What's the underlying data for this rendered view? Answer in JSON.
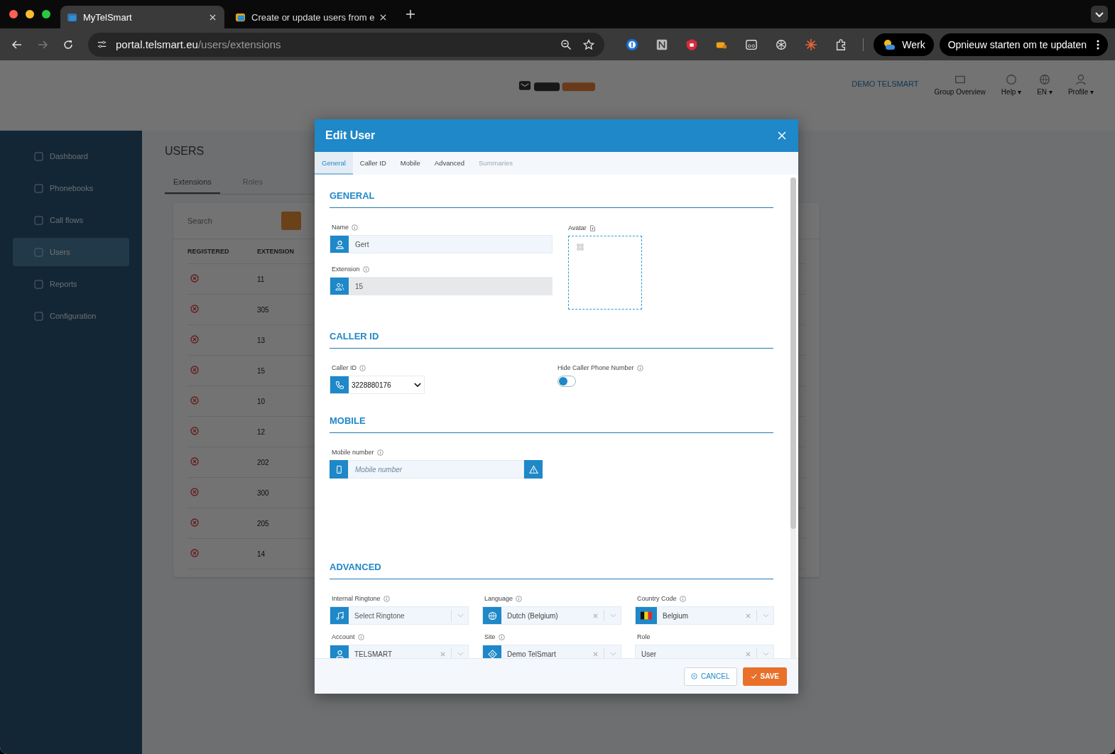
{
  "browser": {
    "tabs": [
      {
        "title": "MyTelSmart",
        "selected": true
      },
      {
        "title": "Create or update users from e",
        "selected": false
      }
    ],
    "url": {
      "host": "portal.telsmart.eu",
      "path": "/users/extensions"
    },
    "profile": "Werk",
    "update_button": "Opnieuw starten om te updaten"
  },
  "header": {
    "account": "DEMO TELSMART",
    "menu": [
      {
        "label": "Group Overview",
        "kind": "group"
      },
      {
        "label": "Help ▾",
        "kind": "help"
      },
      {
        "label": "EN ▾",
        "kind": "globe"
      },
      {
        "label": "Profile ▾",
        "kind": "user"
      }
    ]
  },
  "sidebar": {
    "items": [
      {
        "label": "Dashboard",
        "selected": false
      },
      {
        "label": "Phonebooks",
        "selected": false
      },
      {
        "label": "Call flows",
        "selected": false
      },
      {
        "label": "Users",
        "selected": true
      },
      {
        "label": "Reports",
        "selected": false
      },
      {
        "label": "Configuration",
        "selected": false
      }
    ]
  },
  "page": {
    "title": "USERS",
    "tabs": [
      {
        "label": "Extensions",
        "selected": true
      },
      {
        "label": "Roles",
        "selected": false
      }
    ],
    "search": {
      "placeholder": "Search"
    },
    "columns": [
      "REGISTERED",
      "EXTENSION"
    ],
    "rows": [
      {
        "registered": false,
        "extension": "11"
      },
      {
        "registered": false,
        "extension": "305"
      },
      {
        "registered": false,
        "extension": "13"
      },
      {
        "registered": false,
        "extension": "15"
      },
      {
        "registered": false,
        "extension": "10"
      },
      {
        "registered": false,
        "extension": "12"
      },
      {
        "registered": false,
        "extension": "202"
      },
      {
        "registered": false,
        "extension": "300"
      },
      {
        "registered": false,
        "extension": "205"
      },
      {
        "registered": false,
        "extension": "14"
      }
    ]
  },
  "modal": {
    "title": "Edit User",
    "tabs": [
      {
        "label": "General",
        "selected": true,
        "disabled": false
      },
      {
        "label": "Caller ID",
        "selected": false,
        "disabled": false
      },
      {
        "label": "Mobile",
        "selected": false,
        "disabled": false
      },
      {
        "label": "Advanced",
        "selected": false,
        "disabled": false
      },
      {
        "label": "Summaries",
        "selected": false,
        "disabled": true
      }
    ],
    "general": {
      "heading": "GENERAL",
      "name": {
        "label": "Name",
        "value": "Gert"
      },
      "extension": {
        "label": "Extension",
        "value": "15",
        "disabled": true
      },
      "avatar": {
        "label": "Avatar"
      }
    },
    "caller_id": {
      "heading": "CALLER ID",
      "select": {
        "label": "Caller ID",
        "value": "3228880176"
      },
      "hide_number": {
        "label": "Hide Caller Phone Number",
        "on": false
      }
    },
    "mobile": {
      "heading": "MOBILE",
      "field": {
        "label": "Mobile number",
        "placeholder": "Mobile number"
      }
    },
    "advanced": {
      "heading": "ADVANCED",
      "fields": [
        {
          "label": "Internal Ringtone",
          "info": true,
          "kind": "music",
          "placeholder": "Select Ringtone",
          "clearable": false
        },
        {
          "label": "Language",
          "info": true,
          "kind": "globe",
          "value": "Dutch (Belgium)",
          "clearable": true
        },
        {
          "label": "Country Code",
          "info": true,
          "kind": "flag",
          "value": "Belgium",
          "clearable": true
        },
        {
          "label": "Account",
          "info": true,
          "kind": "user",
          "value": "TELSMART",
          "clearable": true
        },
        {
          "label": "Site",
          "info": true,
          "kind": "site",
          "value": "Demo TelSmart",
          "clearable": true
        },
        {
          "label": "Role",
          "info": false,
          "kind": "plain",
          "value": "User",
          "clearable": true
        }
      ]
    },
    "buttons": {
      "cancel": "CANCEL",
      "save": "SAVE"
    }
  }
}
